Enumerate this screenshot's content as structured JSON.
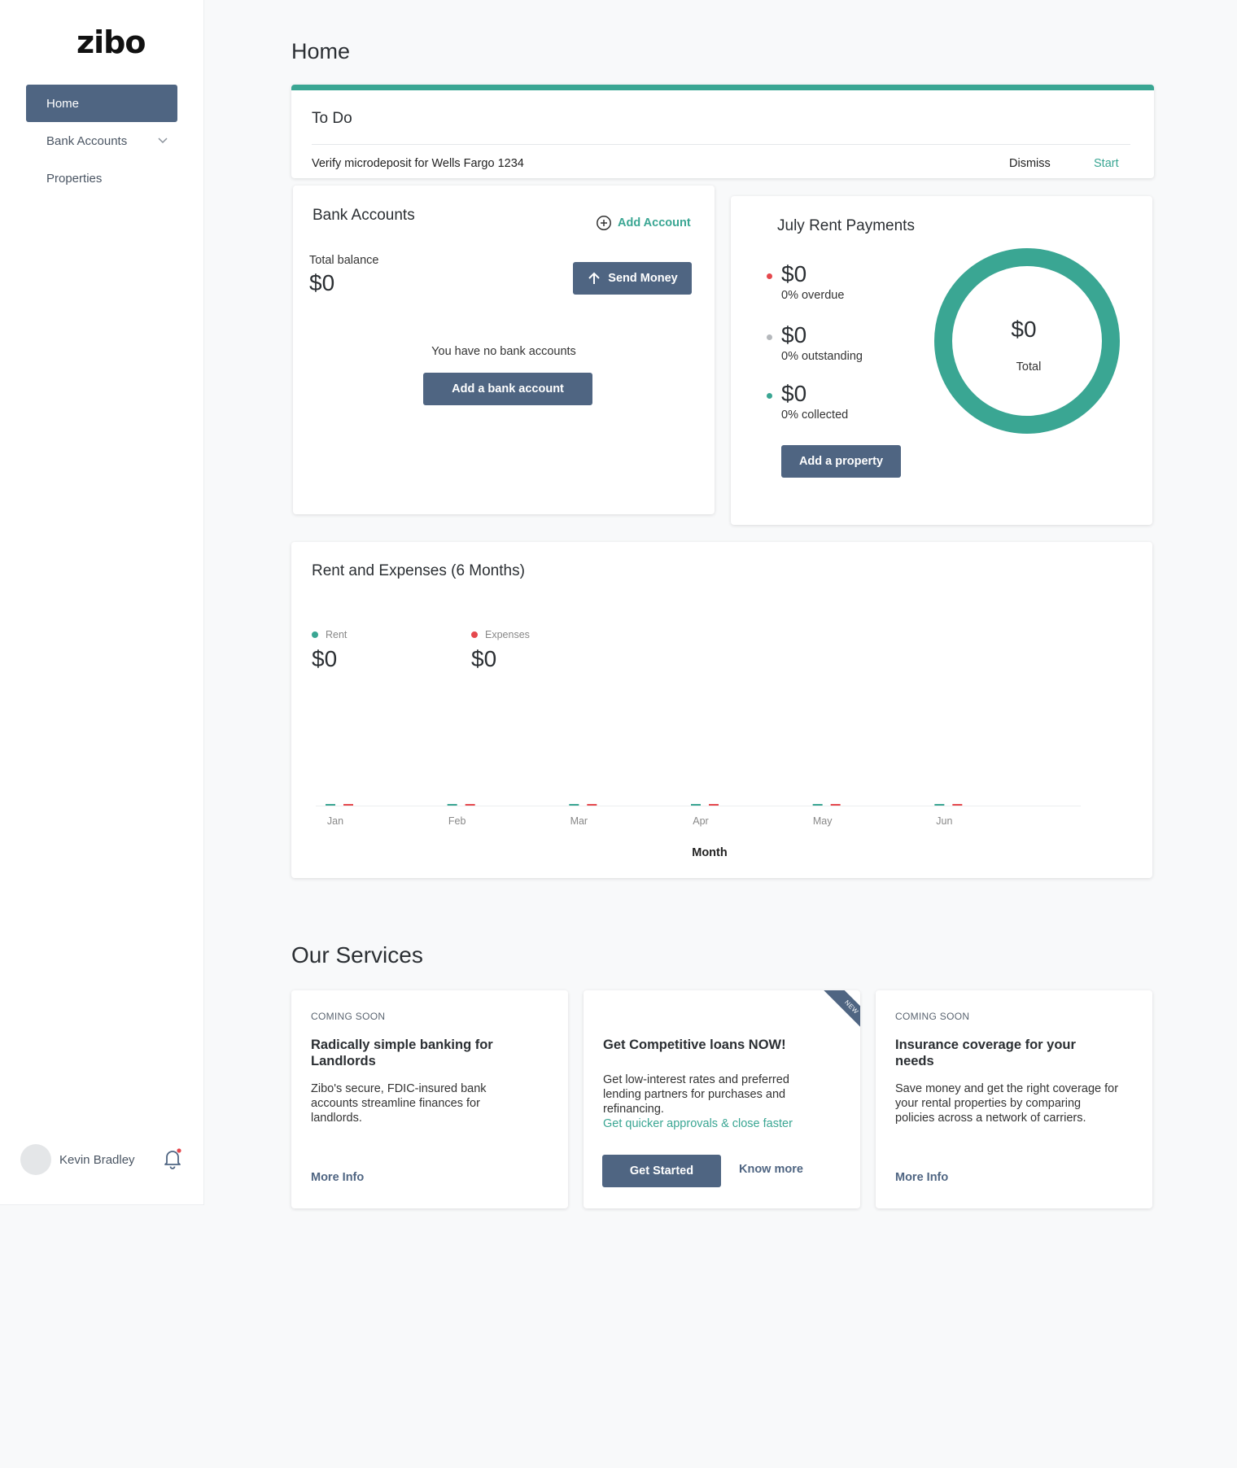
{
  "app": {
    "logo": "zibo"
  },
  "sidebar": {
    "items": [
      {
        "label": "Home",
        "active": true
      },
      {
        "label": "Bank Accounts",
        "expandable": true
      },
      {
        "label": "Properties"
      }
    ],
    "user": {
      "name": "Kevin Bradley",
      "has_notification": true
    }
  },
  "page": {
    "title": "Home"
  },
  "todo": {
    "title": "To Do",
    "item": "Verify microdeposit for Wells Fargo 1234",
    "dismiss_label": "Dismiss",
    "start_label": "Start"
  },
  "bank_accounts": {
    "title": "Bank Accounts",
    "add_account_label": "Add Account",
    "total_balance_label": "Total balance",
    "total_balance_value": "$0",
    "send_money_label": "Send Money",
    "empty_message": "You have no bank accounts",
    "add_bank_account_label": "Add a bank account"
  },
  "rent_payments": {
    "title": "July Rent Payments",
    "rows": [
      {
        "amount": "$0",
        "label": "0% overdue",
        "color": "#e5484d"
      },
      {
        "amount": "$0",
        "label": "0% outstanding",
        "color": "#b5b8bc"
      },
      {
        "amount": "$0",
        "label": "0% collected",
        "color": "#3aa693"
      }
    ],
    "total_value": "$0",
    "total_label": "Total",
    "add_property_label": "Add a property",
    "ring_color": "#3aa693"
  },
  "rent_expenses": {
    "title": "Rent and Expenses (6 Months)",
    "rent_legend": "Rent",
    "rent_value": "$0",
    "expenses_legend": "Expenses",
    "expenses_value": "$0",
    "xlabel": "Month"
  },
  "chart_data": {
    "type": "bar",
    "title": "Rent and Expenses (6 Months)",
    "xlabel": "Month",
    "categories": [
      "Jan",
      "Feb",
      "Mar",
      "Apr",
      "May",
      "Jun"
    ],
    "series": [
      {
        "name": "Rent",
        "color": "#3aa693",
        "values": [
          0,
          0,
          0,
          0,
          0,
          0
        ]
      },
      {
        "name": "Expenses",
        "color": "#e5484d",
        "values": [
          0,
          0,
          0,
          0,
          0,
          0
        ]
      }
    ]
  },
  "services": {
    "title": "Our Services",
    "cards": [
      {
        "tag": "COMING SOON",
        "title": "Radically simple banking for Landlords",
        "description": "Zibo's secure, FDIC-insured bank accounts streamline finances for landlords.",
        "link_label": "More Info"
      },
      {
        "ribbon": "NEW",
        "title": "Get Competitive loans NOW!",
        "description": "Get low-interest rates and preferred lending partners for purchases and refinancing.",
        "accent_link": "Get quicker approvals & close faster",
        "primary_label": "Get Started",
        "secondary_label": "Know more"
      },
      {
        "tag": "COMING SOON",
        "title": "Insurance coverage for your needs",
        "description": "Save money and get the right coverage for your rental properties by comparing policies across a network of carriers.",
        "link_label": "More Info"
      }
    ]
  }
}
